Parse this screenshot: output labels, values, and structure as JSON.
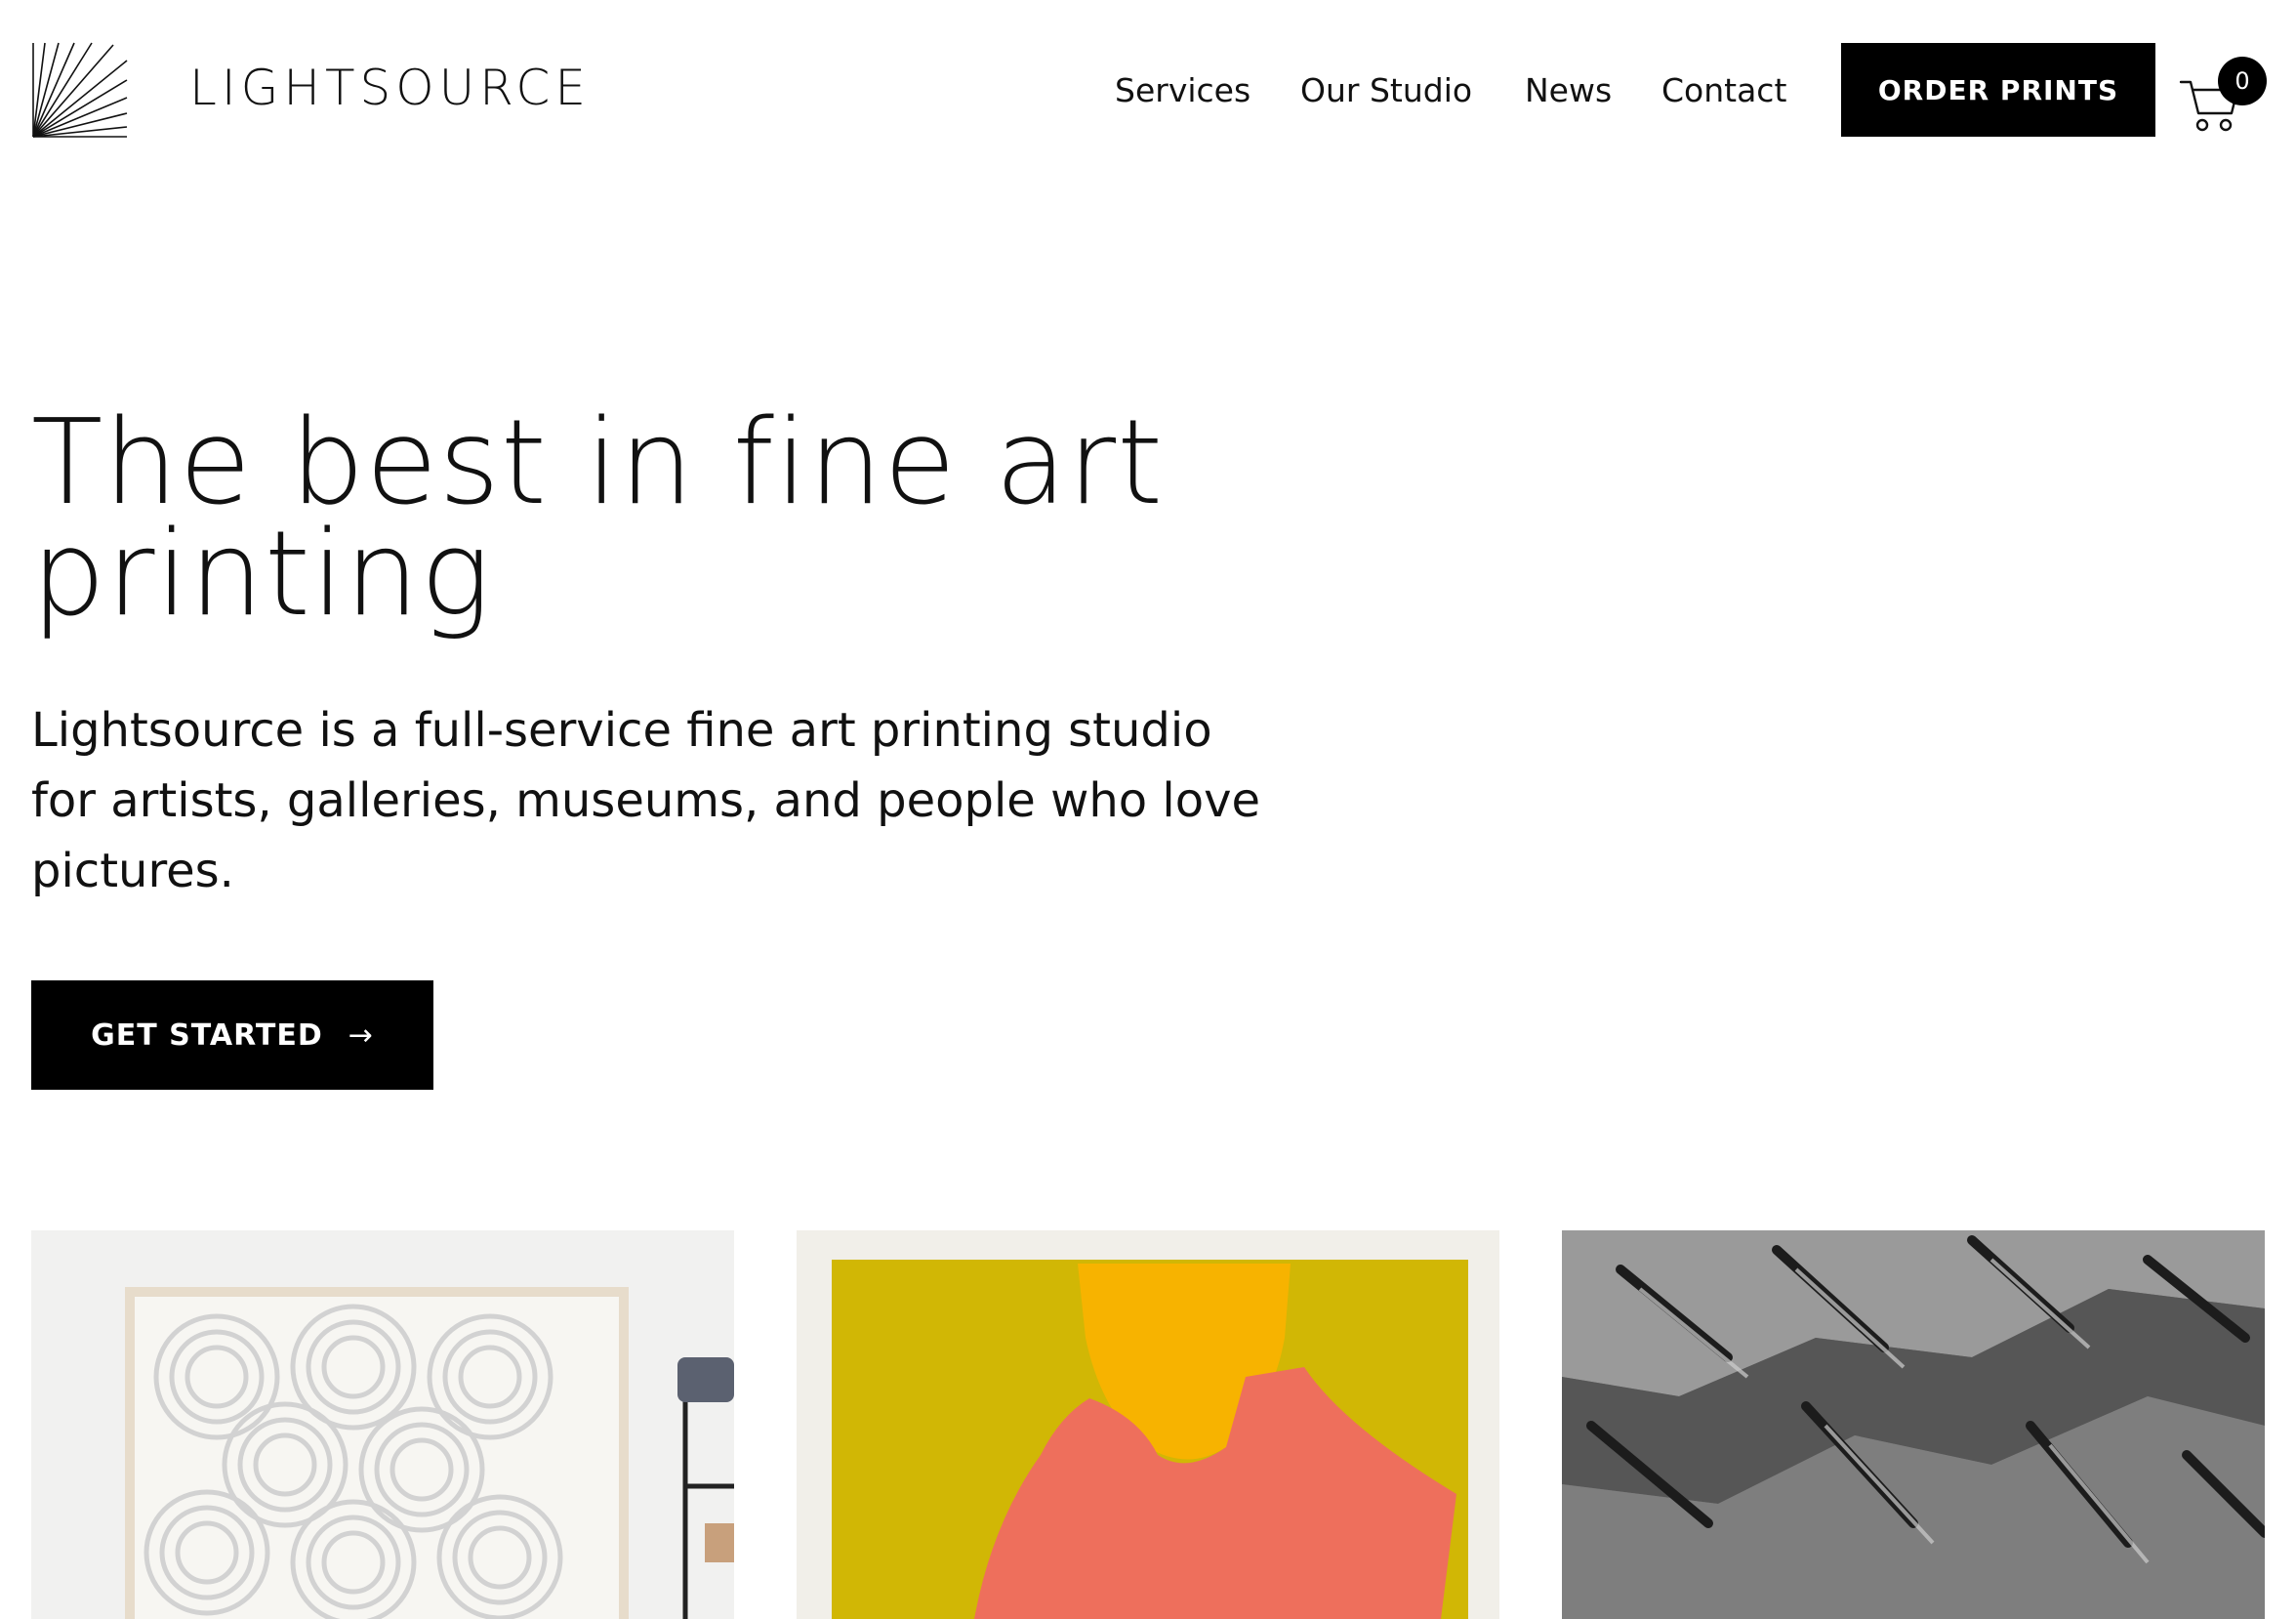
{
  "brand": {
    "name": "LIGHTSOURCE",
    "logo_icon": "sunburst-logo-icon"
  },
  "nav": {
    "items": [
      {
        "label": "Services"
      },
      {
        "label": "Our Studio"
      },
      {
        "label": "News"
      },
      {
        "label": "Contact"
      }
    ],
    "order_label": "ORDER PRINTS"
  },
  "cart": {
    "icon": "shopping-cart-icon",
    "count": "0"
  },
  "hero": {
    "title_line1": "The best in fine art",
    "title_line2": "printing",
    "body_line1": "Lightsource is a full-service fine art printing studio",
    "body_line2": "for artists, galleries, museums, and people who love",
    "body_line3": "pictures.",
    "cta_label": "GET STARTED",
    "cta_icon": "arrow-right-icon"
  },
  "gallery": {
    "tiles": [
      {
        "subject": "framed grey swirl print"
      },
      {
        "subject": "mustard abstract print with orange and coral shapes"
      },
      {
        "subject": "black and white mountain ridge photograph"
      }
    ]
  },
  "colors": {
    "text": "#111111",
    "button_bg": "#000000",
    "button_text": "#ffffff",
    "background": "#ffffff"
  }
}
